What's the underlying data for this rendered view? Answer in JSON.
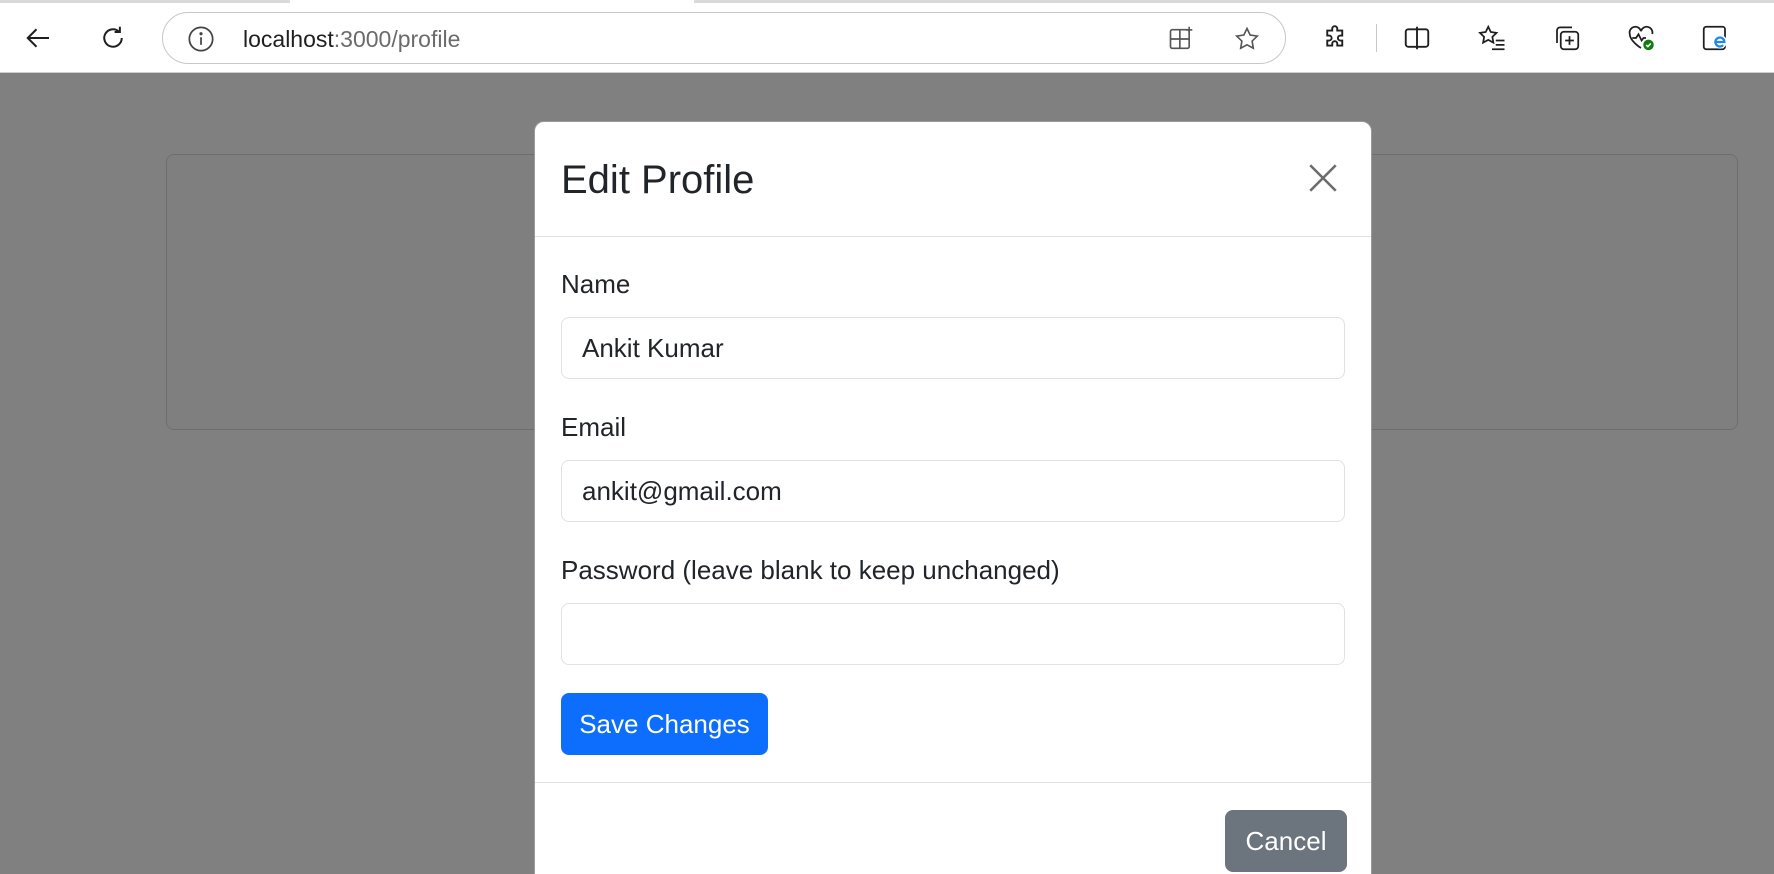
{
  "browser": {
    "url_host": "localhost",
    "url_path": ":3000/profile",
    "icons": [
      "back-icon",
      "refresh-icon",
      "info-icon",
      "app-available-icon",
      "favorite-star-icon",
      "extensions-icon",
      "split-screen-icon",
      "favorites-icon",
      "collections-icon",
      "browser-essentials-icon",
      "ie-mode-icon"
    ]
  },
  "modal": {
    "title": "Edit Profile",
    "fields": [
      {
        "label": "Name",
        "value": "Ankit Kumar",
        "placeholder": ""
      },
      {
        "label": "Email",
        "value": "ankit@gmail.com",
        "placeholder": ""
      },
      {
        "label": "Password (leave blank to keep unchanged)",
        "value": "",
        "placeholder": ""
      }
    ],
    "save_label": "Save Changes",
    "cancel_label": "Cancel"
  },
  "colors": {
    "primary": "#0d6efd",
    "secondary": "#6c757d",
    "backdrop": "#808080"
  }
}
